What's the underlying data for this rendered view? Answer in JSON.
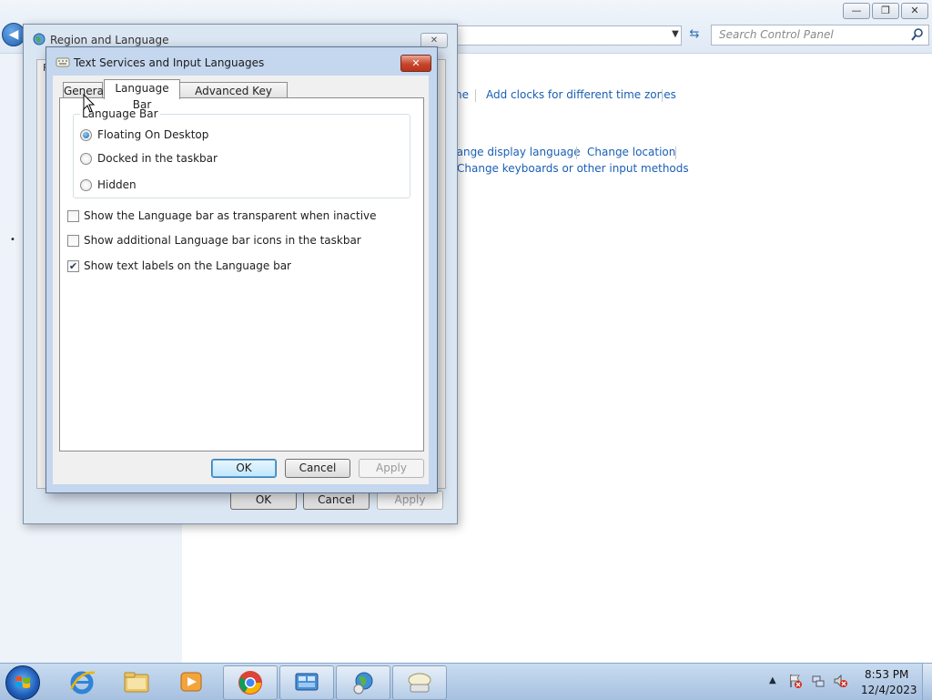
{
  "control_panel": {
    "search_placeholder": "Search Control Panel",
    "links_row1": [
      "ne",
      "Add clocks for different time zones"
    ],
    "links_row2": [
      "hange display language",
      "Change location"
    ],
    "links_row3": [
      "Change keyboards or other input methods"
    ],
    "bullet": "•"
  },
  "region_dialog": {
    "title": "Region and Language",
    "close": "✕",
    "buttons": {
      "ok": "OK",
      "cancel": "Cancel",
      "apply": "Apply"
    },
    "tab_stub": "F"
  },
  "text_services_dialog": {
    "title": "Text Services and Input Languages",
    "close": "✕",
    "tabs": [
      "General",
      "Language Bar",
      "Advanced Key Settings"
    ],
    "active_tab": "Language Bar",
    "group_label": "Language Bar",
    "radios": [
      {
        "label": "Floating On Desktop",
        "selected": true
      },
      {
        "label": "Docked in the taskbar",
        "selected": false
      },
      {
        "label": "Hidden",
        "selected": false
      }
    ],
    "checkboxes": [
      {
        "label": "Show the Language bar as transparent when inactive",
        "checked": false
      },
      {
        "label": "Show additional Language bar icons in the taskbar",
        "checked": false
      },
      {
        "label": "Show text labels on the Language bar",
        "checked": true
      }
    ],
    "buttons": {
      "ok": "OK",
      "cancel": "Cancel",
      "apply": "Apply"
    }
  },
  "taskbar": {
    "clock_time": "8:53 PM",
    "clock_date": "12/4/2023",
    "pinned": [
      "internet-explorer-icon",
      "file-explorer-icon",
      "media-player-icon",
      "chrome-icon",
      "control-panel-icon",
      "region-language-icon",
      "text-services-icon"
    ]
  },
  "window_controls": {
    "minimize": "—",
    "maximize": "❐",
    "close": "✕"
  },
  "colors": {
    "accent": "#1a5fb4",
    "taskbar": "#b7cde8",
    "close_red": "#c7452a"
  }
}
